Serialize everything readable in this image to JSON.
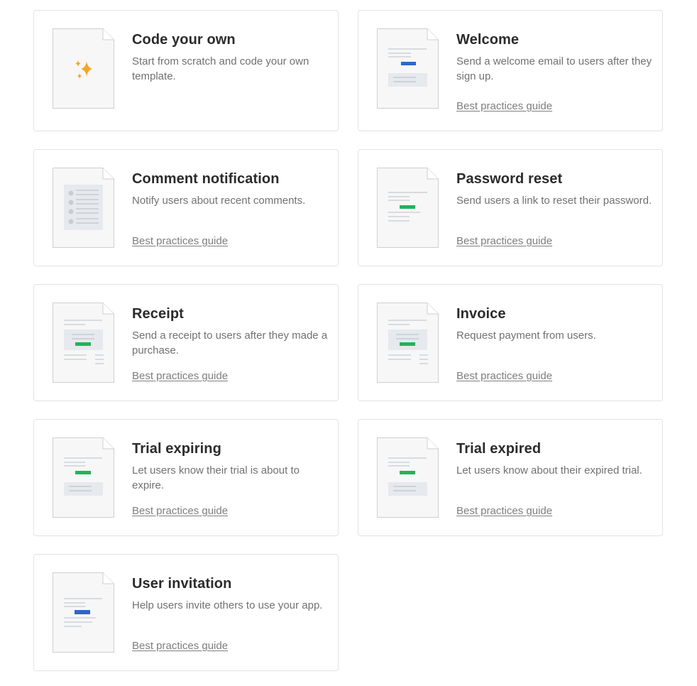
{
  "colors": {
    "brand_blue": "#2f67c9",
    "brand_green": "#1fb45c",
    "sparkle": "#f5a623",
    "doc_border": "#cfcfcf",
    "doc_fill": "#f7f7f7"
  },
  "templates": [
    {
      "title": "Code your own",
      "description": "Start from scratch and code your own template.",
      "link": "",
      "icon": "sparkles-icon"
    },
    {
      "title": "Welcome",
      "description": "Send a welcome email to users after they sign up.",
      "link": "Best practices guide",
      "icon": "welcome-doc-icon"
    },
    {
      "title": "Comment notification",
      "description": "Notify users about recent comments.",
      "link": "Best practices guide",
      "icon": "comment-doc-icon"
    },
    {
      "title": "Password reset",
      "description": "Send users a link to reset their password.",
      "link": "Best practices guide",
      "icon": "password-doc-icon"
    },
    {
      "title": "Receipt",
      "description": "Send a receipt to users after they made a purchase.",
      "link": "Best practices guide",
      "icon": "receipt-doc-icon"
    },
    {
      "title": "Invoice",
      "description": "Request payment from users.",
      "link": "Best practices guide",
      "icon": "invoice-doc-icon"
    },
    {
      "title": "Trial expiring",
      "description": "Let users know their trial is about to expire.",
      "link": "Best practices guide",
      "icon": "trial-expiring-doc-icon"
    },
    {
      "title": "Trial expired",
      "description": "Let users know about their expired trial.",
      "link": "Best practices guide",
      "icon": "trial-expired-doc-icon"
    },
    {
      "title": "User invitation",
      "description": "Help users invite others to use your app.",
      "link": "Best practices guide",
      "icon": "invitation-doc-icon"
    }
  ]
}
